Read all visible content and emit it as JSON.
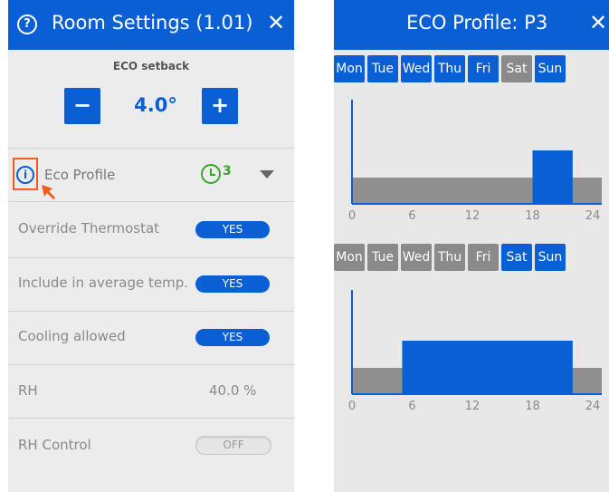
{
  "left": {
    "header": {
      "title": "Room Settings (1.01)",
      "help_icon": "question-circle-icon",
      "close_icon": "close-icon"
    },
    "eco_setback": {
      "label": "ECO setback",
      "minus": "−",
      "plus": "+",
      "value": "4.0°"
    },
    "rows": [
      {
        "label": "Eco Profile",
        "profile_number": "3"
      },
      {
        "label": "Override Thermostat",
        "toggle": "YES"
      },
      {
        "label": "Include in average temp.",
        "toggle": "YES"
      },
      {
        "label": "Cooling allowed",
        "toggle": "YES"
      },
      {
        "label": "RH",
        "value": "40.0 %"
      },
      {
        "label": "RH Control",
        "toggle": "OFF"
      }
    ],
    "colors": {
      "accent": "#0a5fd4",
      "green": "#3aa52a",
      "highlight": "#f05a1a"
    }
  },
  "right": {
    "header": {
      "title": "ECO Profile: P3",
      "close_icon": "close-icon"
    },
    "schedules": [
      {
        "days": [
          {
            "label": "Mon",
            "active": true
          },
          {
            "label": "Tue",
            "active": true
          },
          {
            "label": "Wed",
            "active": true
          },
          {
            "label": "Thu",
            "active": true
          },
          {
            "label": "Fri",
            "active": true
          },
          {
            "label": "Sat",
            "active": false
          },
          {
            "label": "Sun",
            "active": true
          }
        ],
        "chart_data": {
          "type": "area",
          "x_ticks": [
            "0",
            "6",
            "12",
            "18",
            "24"
          ],
          "xlim": [
            0,
            24
          ],
          "eco_periods": [
            {
              "from": 18,
              "to": 22
            }
          ]
        }
      },
      {
        "days": [
          {
            "label": "Mon",
            "active": false
          },
          {
            "label": "Tue",
            "active": false
          },
          {
            "label": "Wed",
            "active": false
          },
          {
            "label": "Thu",
            "active": false
          },
          {
            "label": "Fri",
            "active": false
          },
          {
            "label": "Sat",
            "active": true
          },
          {
            "label": "Sun",
            "active": true
          }
        ],
        "chart_data": {
          "type": "area",
          "x_ticks": [
            "0",
            "6",
            "12",
            "18",
            "24"
          ],
          "xlim": [
            0,
            24
          ],
          "eco_periods": [
            {
              "from": 5,
              "to": 22
            }
          ]
        }
      }
    ]
  }
}
